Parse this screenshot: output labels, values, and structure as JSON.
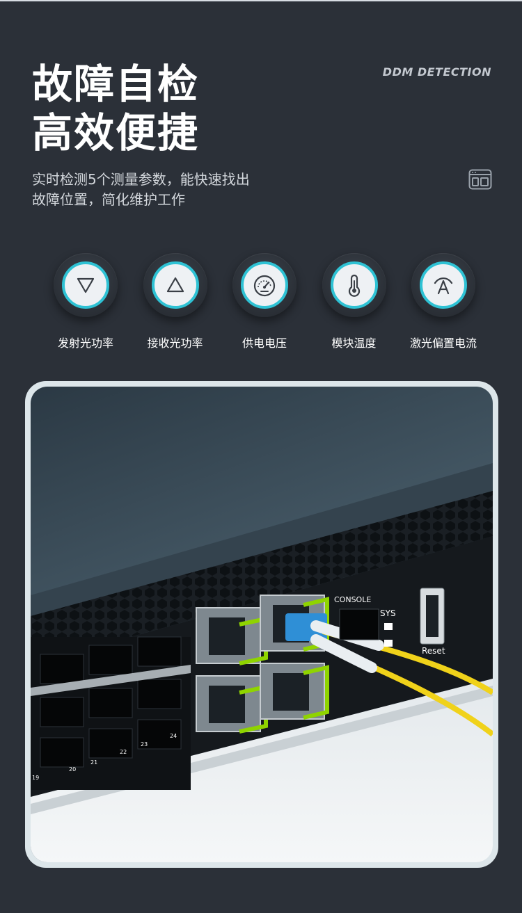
{
  "header": {
    "title_line1": "故障自检",
    "title_line2": "高效便捷",
    "tag": "DDM DETECTION",
    "desc_line1": "实时检测5个测量参数，能快速找出",
    "desc_line2": "故障位置，简化维护工作",
    "browser_icon": "browser-window-icon"
  },
  "features": [
    {
      "label": "发射光功率",
      "icon": "triangle-down-icon"
    },
    {
      "label": "接收光功率",
      "icon": "triangle-up-icon"
    },
    {
      "label": "供电电压",
      "icon": "gauge-icon"
    },
    {
      "label": "模块温度",
      "icon": "thermometer-icon"
    },
    {
      "label": "激光偏置电流",
      "icon": "laser-a-icon"
    }
  ],
  "photo": {
    "console_label": "CONSOLE",
    "sys_label": "SYS",
    "reset_label": "Reset",
    "port_numbers": [
      "19",
      "20",
      "21",
      "22",
      "23",
      "24"
    ]
  },
  "colors": {
    "background": "#2b3038",
    "accent": "#2ec2d4",
    "module_green": "#8fd400",
    "fiber_yellow": "#f0d21a"
  }
}
